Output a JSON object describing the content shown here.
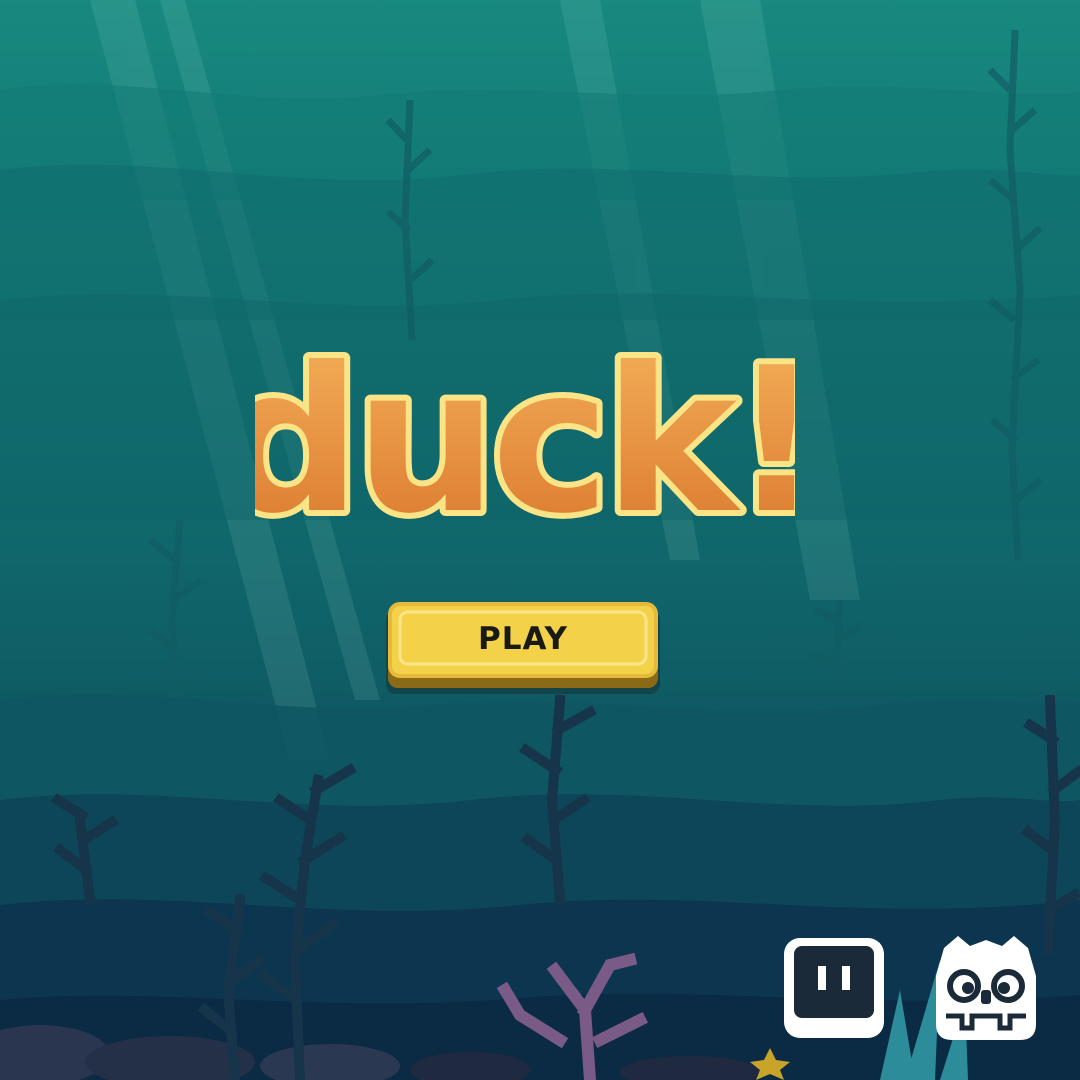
{
  "game": {
    "title": "duck!",
    "menu": {
      "play_label": "PLAY"
    }
  },
  "badges": [
    {
      "icon": "itch-io-icon",
      "label": ""
    },
    {
      "icon": "godot-engine-icon",
      "label": ""
    }
  ],
  "colors": {
    "water_top": "#18897f",
    "water_bottom": "#0b3148",
    "title_fill": "#e8913a",
    "title_outline": "#f9e27a",
    "button_fill": "#f3d24a",
    "button_shadow": "#8a6a17",
    "kelp_dark": "#163c52",
    "coral_purple": "#7a5a86",
    "logo_white": "#ffffff"
  }
}
